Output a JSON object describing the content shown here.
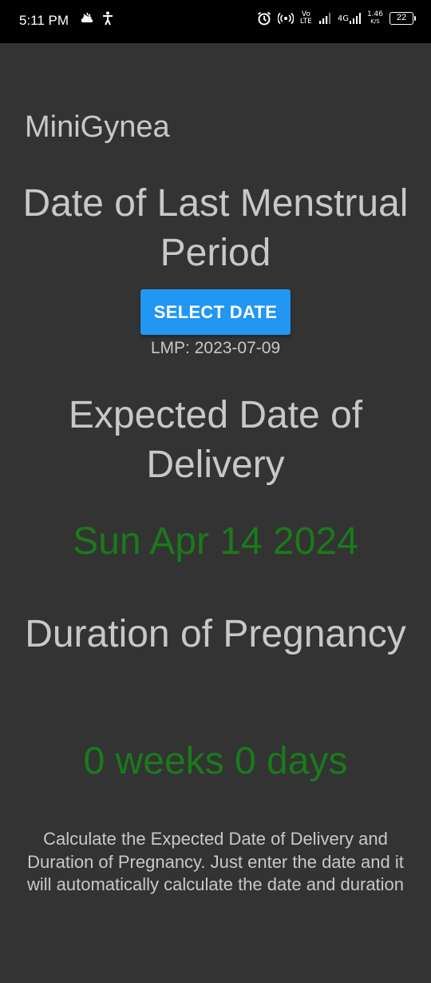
{
  "status_bar": {
    "time": "5:11 PM",
    "volte": "Vo",
    "volte_sub": "LTE",
    "network": "4G",
    "speed": "1.46",
    "speed_unit": "K/S",
    "battery": "22",
    "icons": [
      "cloud-icon",
      "accessibility-icon",
      "alarm-icon",
      "hotspot-icon",
      "signal-icon",
      "signal-icon-2",
      "battery-icon"
    ]
  },
  "app": {
    "title": "MiniGynea"
  },
  "lmp_section": {
    "heading": "Date of Last Menstrual Period",
    "button_label": "SELECT DATE",
    "lmp_value": "LMP: 2023-07-09"
  },
  "edd_section": {
    "heading": "Expected Date of Delivery",
    "value": "Sun Apr 14 2024"
  },
  "duration_section": {
    "heading": "Duration of Pregnancy",
    "value": "0 weeks 0 days"
  },
  "description": "Calculate the Expected Date of Delivery and Duration of Pregnancy. Just enter the date and it will automatically calculate the date and duration",
  "colors": {
    "background": "#333333",
    "text": "#c8c8c8",
    "accent_green": "#1a7a1a",
    "button": "#2196f3"
  }
}
